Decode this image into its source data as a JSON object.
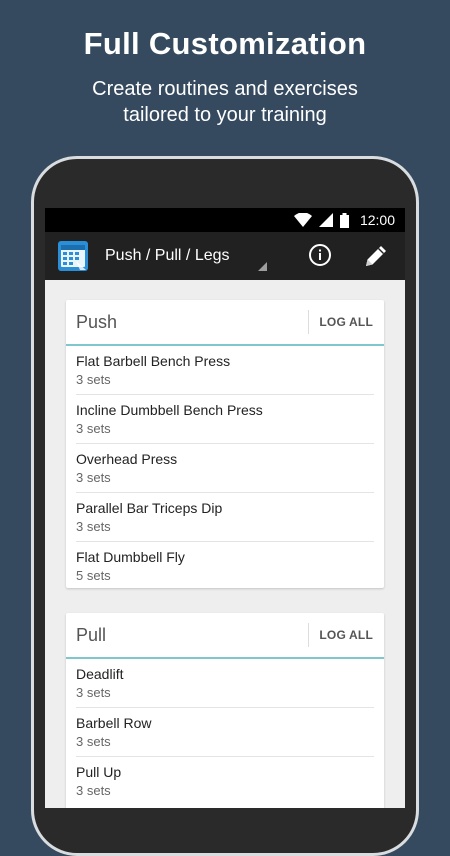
{
  "promo": {
    "title": "Full Customization",
    "subtitle_line1": "Create routines and exercises",
    "subtitle_line2": "tailored to your training"
  },
  "status_bar": {
    "time": "12:00",
    "icons": [
      "wifi-icon",
      "signal-icon",
      "battery-icon"
    ]
  },
  "app_bar": {
    "title": "Push / Pull / Legs",
    "icons": [
      "calendar-app-icon",
      "info-icon",
      "pencil-icon"
    ]
  },
  "colors": {
    "background": "#364a5f",
    "app_bar": "#212121",
    "accent_line": "#7fc6cf",
    "app_icon": "#2a8fd6"
  },
  "routines": [
    {
      "name": "Push",
      "action": "LOG ALL",
      "exercises": [
        {
          "name": "Flat Barbell Bench Press",
          "sets": "3 sets"
        },
        {
          "name": "Incline Dumbbell Bench Press",
          "sets": "3 sets"
        },
        {
          "name": "Overhead Press",
          "sets": "3 sets"
        },
        {
          "name": "Parallel Bar Triceps Dip",
          "sets": "3 sets"
        },
        {
          "name": "Flat Dumbbell Fly",
          "sets": "5 sets"
        }
      ]
    },
    {
      "name": "Pull",
      "action": "LOG ALL",
      "exercises": [
        {
          "name": "Deadlift",
          "sets": "3 sets"
        },
        {
          "name": "Barbell Row",
          "sets": "3 sets"
        },
        {
          "name": "Pull Up",
          "sets": "3 sets"
        }
      ]
    }
  ]
}
